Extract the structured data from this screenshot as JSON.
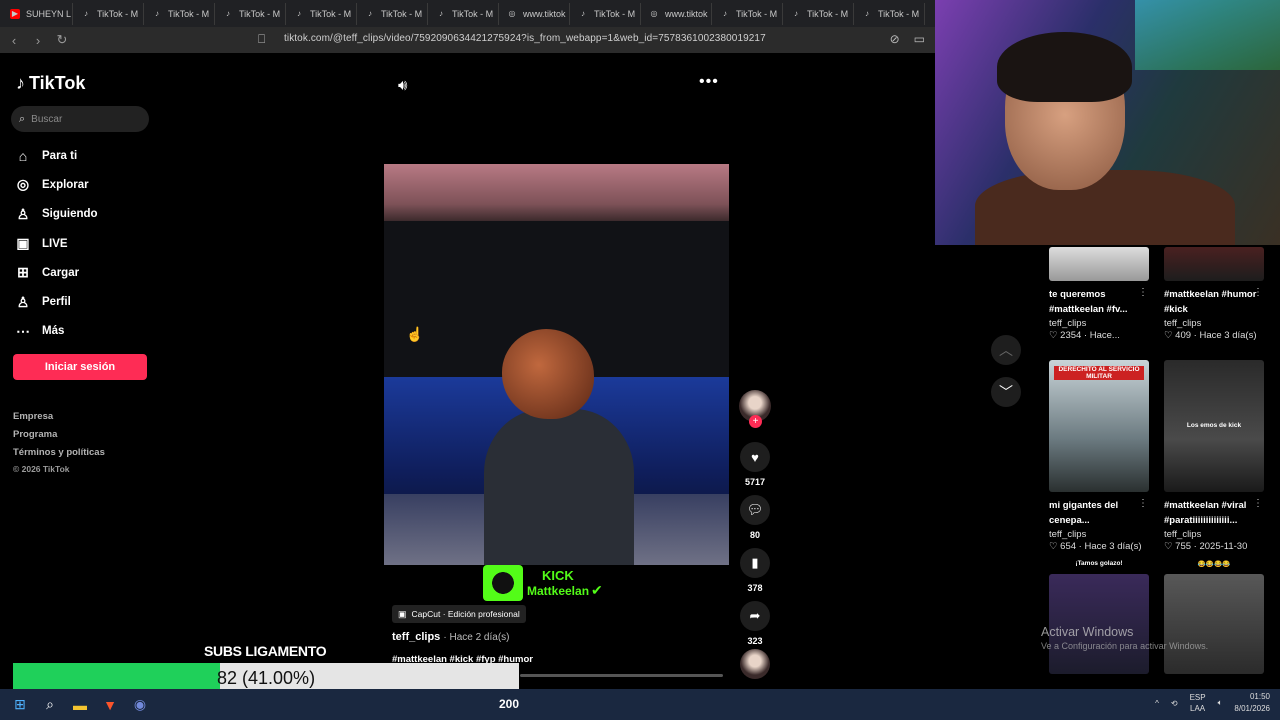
{
  "browser": {
    "tabs": [
      {
        "label": "SUHEYN L",
        "icon": "youtube-icon"
      },
      {
        "label": "TikTok - M",
        "icon": "tiktok-icon"
      },
      {
        "label": "TikTok - M",
        "icon": "tiktok-icon"
      },
      {
        "label": "TikTok - M",
        "icon": "tiktok-icon"
      },
      {
        "label": "TikTok - M",
        "icon": "tiktok-icon"
      },
      {
        "label": "TikTok - M",
        "icon": "tiktok-icon"
      },
      {
        "label": "TikTok - M",
        "icon": "tiktok-icon"
      },
      {
        "label": "www.tiktok",
        "icon": "globe-icon"
      },
      {
        "label": "TikTok - M",
        "icon": "tiktok-icon"
      },
      {
        "label": "www.tiktok",
        "icon": "globe-icon"
      },
      {
        "label": "TikTok - M",
        "icon": "tiktok-icon"
      },
      {
        "label": "TikTok - M",
        "icon": "tiktok-icon"
      },
      {
        "label": "TikTok - M",
        "icon": "tiktok-icon"
      }
    ],
    "url": "tiktok.com/@teff_clips/video/7592090634421275924?is_from_webapp=1&web_id=7578361002380019217"
  },
  "sidebar": {
    "logo": "TikTok",
    "search_placeholder": "Buscar",
    "items": [
      {
        "label": "Para ti",
        "icon": "home-icon"
      },
      {
        "label": "Explorar",
        "icon": "compass-icon"
      },
      {
        "label": "Siguiendo",
        "icon": "following-icon"
      },
      {
        "label": "LIVE",
        "icon": "live-icon"
      },
      {
        "label": "Cargar",
        "icon": "upload-icon"
      },
      {
        "label": "Perfil",
        "icon": "profile-icon"
      },
      {
        "label": "Más",
        "icon": "more-icon"
      }
    ],
    "login": "Iniciar sesión",
    "footer": [
      "Empresa",
      "Programa",
      "Términos y políticas"
    ],
    "copyright": "© 2026 TikTok"
  },
  "video": {
    "overlay_line1": "KICK",
    "overlay_line2": "Mattkeelan",
    "capcut": "CapCut · Edición profesional",
    "author": "teff_clips",
    "time": "· Hace 2 día(s)",
    "hashtags": "#mattkeelan #kick #fyp #humor",
    "likes": "5717",
    "comments": "80",
    "saves": "378",
    "shares": "323"
  },
  "related": [
    {
      "title": "te queremos #mattkeelan #fv...",
      "user": "teff_clips",
      "likes": "2354",
      "time": "Hace...",
      "thumb_text": ""
    },
    {
      "title": "#mattkeelan #humor #kick",
      "user": "teff_clips",
      "likes": "409",
      "time": "Hace 3 día(s)",
      "thumb_text": ""
    },
    {
      "title": "mi gigantes del cenepa...",
      "user": "teff_clips",
      "likes": "654",
      "time": "Hace 3 día(s)",
      "thumb_text": "DERECHITO AL SERVICIO MILITAR"
    },
    {
      "title": "#mattkeelan #viral #paratiiiiiiiiiiiiii...",
      "user": "teff_clips",
      "likes": "755",
      "time": "2025-11-30",
      "thumb_text": "Los emos de kick"
    },
    {
      "title": "",
      "user": "",
      "likes": "",
      "time": "",
      "thumb_text": "¡Tamos golazo!"
    },
    {
      "title": "",
      "user": "",
      "likes": "",
      "time": "",
      "thumb_text": "😂😂😂😂"
    }
  ],
  "windows_watermark": {
    "line1": "Activar Windows",
    "line2": "Ve a Configuración para activar Windows."
  },
  "subs_goal": {
    "label": "SUBS LIGAMENTO",
    "text": "82 (41.00%)",
    "progress": 0.41
  },
  "taskbar": {
    "count": "200",
    "lang1": "ESP",
    "lang2": "LAA",
    "time": "01:50",
    "date": "8/01/2026"
  }
}
